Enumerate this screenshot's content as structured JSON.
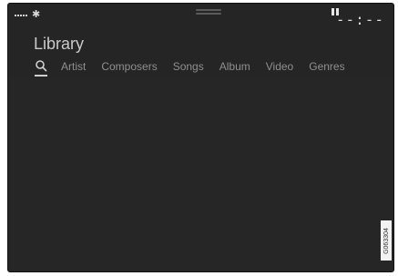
{
  "status_bar": {
    "bluetooth_icon": "bluetooth-icon",
    "clock": "--:--"
  },
  "page": {
    "title": "Library"
  },
  "tabs": {
    "search_icon": "search-icon",
    "items": [
      {
        "label": "Artist"
      },
      {
        "label": "Composers"
      },
      {
        "label": "Songs"
      },
      {
        "label": "Album"
      },
      {
        "label": "Video"
      },
      {
        "label": "Genres"
      }
    ]
  },
  "figure_id": "G063304",
  "colors": {
    "background": "#252525",
    "text_primary": "#c9c9c9",
    "text_secondary": "#8f8f8f"
  }
}
